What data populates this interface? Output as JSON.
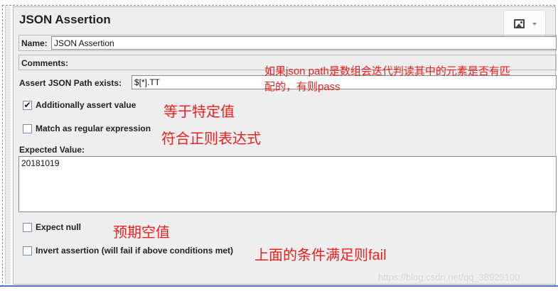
{
  "panel": {
    "title": "JSON Assertion",
    "image_button_icon": "image-icon"
  },
  "form": {
    "name_label": "Name:",
    "name_value": "JSON Assertion",
    "comments_label": "Comments:",
    "comments_value": "",
    "path_label": "Assert JSON Path exists:",
    "path_value": "$[*].TT",
    "additional_label": "Additionally assert value",
    "additional_checked": true,
    "regex_label": "Match as regular expression",
    "regex_checked": false,
    "expected_label": "Expected Value:",
    "expected_value": "20181019",
    "expect_null_label": "Expect null",
    "expect_null_checked": false,
    "invert_label": "Invert assertion (will fail if above conditions met)",
    "invert_checked": false
  },
  "annotations": {
    "path_note_line1": "如果json path是数组会迭代判读其中的元素是否有匹",
    "path_note_line2": "配的，有则pass",
    "additional_note": "等于特定值",
    "regex_note": "符合正则表达式",
    "null_note": "预期空值",
    "invert_note": "上面的条件满足则fail",
    "color": "#e8201e"
  },
  "watermark": "https://blog.csdn.net/qq_38925100"
}
